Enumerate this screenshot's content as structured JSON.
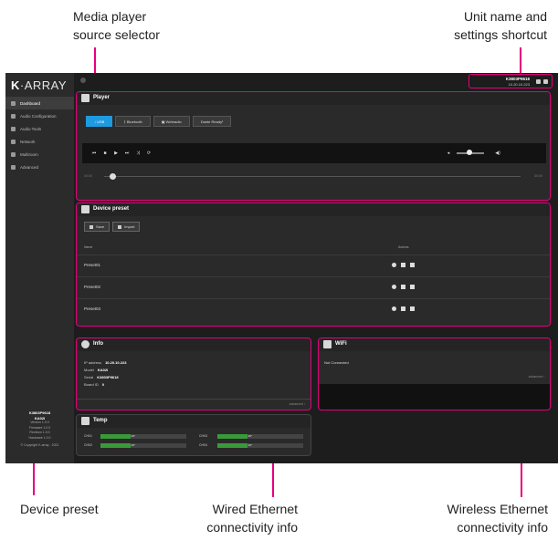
{
  "annotations": {
    "top_left": [
      "Media player",
      "source selector"
    ],
    "top_right": [
      "Unit name and",
      "settings shortcut"
    ],
    "bottom_preset": "Device preset",
    "bottom_wired": [
      "Wired Ethernet",
      "connectivity info"
    ],
    "bottom_wireless": [
      "Wireless Ethernet",
      "connectivity info"
    ]
  },
  "brand": {
    "logo_mark": "K",
    "logo_text": "ARRAY"
  },
  "sidebar": {
    "items": [
      {
        "label": "Dashboard",
        "icon": "dashboard-icon",
        "active": true
      },
      {
        "label": "Audio Configuration",
        "icon": "audio-config-icon",
        "active": false
      },
      {
        "label": "Audio Tools",
        "icon": "audio-tools-icon",
        "active": false
      },
      {
        "label": "Network",
        "icon": "network-icon",
        "active": false
      },
      {
        "label": "Multiroom",
        "icon": "multiroom-icon",
        "active": false
      },
      {
        "label": "Advanced",
        "icon": "gear-icon",
        "active": false
      }
    ],
    "footer": [
      "K3803P9618",
      "KA02I",
      "Version 1.0.0",
      "Firmware 1.0.0",
      "Revision 1.0.0",
      "Hardware 1.0.0",
      "© Copyright K-array - 2021"
    ]
  },
  "unit": {
    "name": "K3803P9618",
    "ip": "10.20.10.223"
  },
  "player": {
    "title": "Player",
    "tabs": [
      {
        "label": "USB",
        "active": true
      },
      {
        "label": "Bluetooth",
        "active": false
      },
      {
        "label": "Webradio",
        "active": false
      },
      {
        "label": "Dante Ready¹",
        "active": false
      }
    ],
    "time_start": "00:00",
    "time_end": "00:00",
    "volume": 0.45,
    "progress": 0.02
  },
  "preset": {
    "title": "Device preset",
    "save_label": "Save",
    "import_label": "Import",
    "col_name": "Name",
    "col_actions": "Actions",
    "rows": [
      "Preset01",
      "Preset02",
      "Preset03"
    ]
  },
  "info": {
    "title": "Info",
    "rows": [
      {
        "k": "IP address",
        "v": "10.20.10.223"
      },
      {
        "k": "Model",
        "v": "KA02I"
      },
      {
        "k": "Serial",
        "v": "K3803P9618"
      },
      {
        "k": "Board ID",
        "v": "0"
      }
    ],
    "advanced": "advanced"
  },
  "wifi": {
    "title": "WiFi",
    "status": "Not Connected",
    "advanced": "advanced"
  },
  "temp": {
    "title": "Temp",
    "channels": [
      {
        "label": "CH01",
        "value": "40°",
        "level": 0.35
      },
      {
        "label": "CH02",
        "value": "40°",
        "level": 0.35
      },
      {
        "label": "CH03",
        "value": "40°",
        "level": 0.35
      },
      {
        "label": "CH04",
        "value": "40°",
        "level": 0.35
      }
    ]
  },
  "colors": {
    "accent": "#e6007e",
    "active_tab": "#1e9be0",
    "temp_fill": "#3a9a3a"
  }
}
